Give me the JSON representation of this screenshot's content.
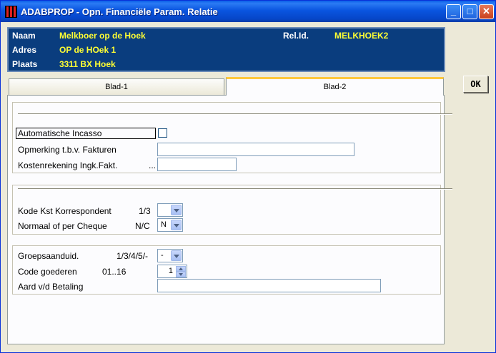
{
  "window": {
    "title": "ADABPROP - Opn. Financiële Param. Relatie",
    "minimize": "_",
    "maximize": "□",
    "close": "✕"
  },
  "header": {
    "naam_label": "Naam",
    "naam_value": "Melkboer op de Hoek",
    "adres_label": "Adres",
    "adres_value": "OP de HOek 1",
    "plaats_label": "Plaats",
    "plaats_value": "3311 BX Hoek",
    "relid_label": "Rel.Id.",
    "relid_value": "MELKHOEK2"
  },
  "ok_button": "OK",
  "tabs": [
    {
      "label": "Blad-1",
      "active": false
    },
    {
      "label": "Blad-2",
      "active": true
    }
  ],
  "group1": {
    "auto_incasso_label": "Automatische Incasso",
    "auto_incasso_checked": false,
    "opmerking_label": "Opmerking t.b.v. Fakturen",
    "opmerking_value": "",
    "kostenrek_label": "Kostenrekening Ingk.Fakt.",
    "kostenrek_hint": "...",
    "kostenrek_value": ""
  },
  "group2": {
    "kode_kst_label": "Kode Kst Korrespondent",
    "kode_kst_hint": "1/3",
    "kode_kst_value": "",
    "normaal_label": "Normaal of per Cheque",
    "normaal_hint": "N/C",
    "normaal_value": "N"
  },
  "group3": {
    "groeps_label": "Groepsaanduid.",
    "groeps_hint": "1/3/4/5/-",
    "groeps_value": "-",
    "code_goed_label": "Code goederen",
    "code_goed_hint": "01..16",
    "code_goed_value": "1",
    "aard_label": "Aard v/d Betaling",
    "aard_value": ""
  },
  "colors": {
    "header_bg": "#0a3d7e",
    "header_value": "#ffff33",
    "tab_highlight": "#ffc83c",
    "titlebar": "#0a55e0"
  }
}
